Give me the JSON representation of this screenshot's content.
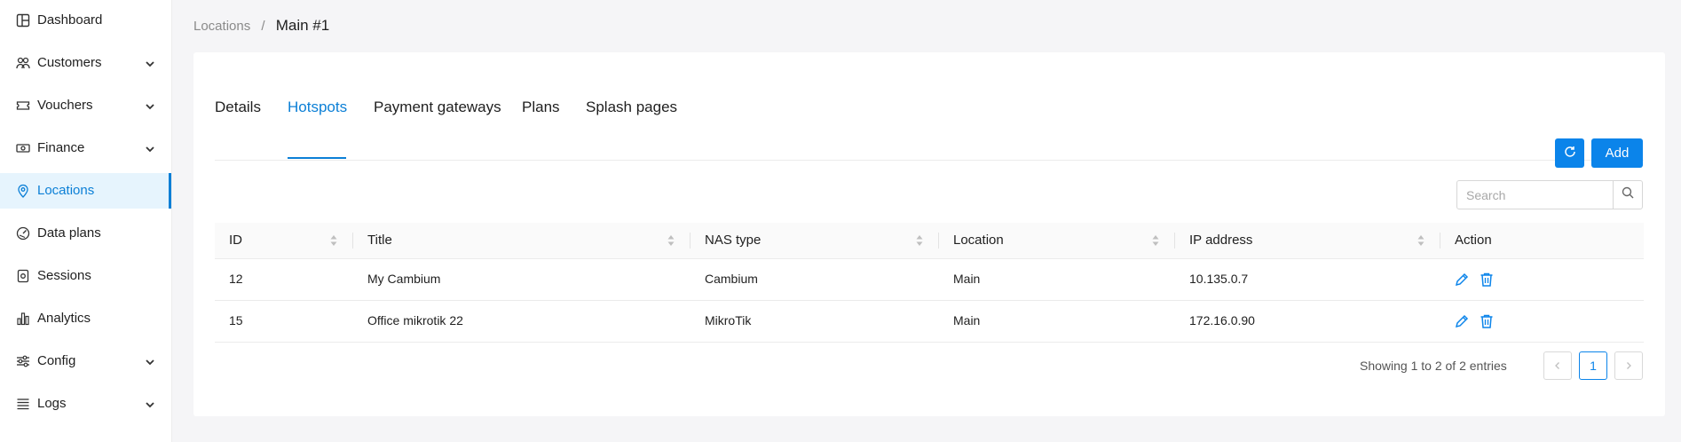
{
  "sidebar": {
    "items": [
      {
        "label": "Dashboard",
        "icon": "dashboard-icon"
      },
      {
        "label": "Customers",
        "icon": "users-icon"
      },
      {
        "label": "Vouchers",
        "icon": "ticket-icon"
      },
      {
        "label": "Finance",
        "icon": "money-icon"
      },
      {
        "label": "Locations",
        "icon": "location-pin-icon"
      },
      {
        "label": "Data plans",
        "icon": "speedometer-icon"
      },
      {
        "label": "Sessions",
        "icon": "sessions-icon"
      },
      {
        "label": "Analytics",
        "icon": "bar-chart-icon"
      },
      {
        "label": "Config",
        "icon": "sliders-icon"
      },
      {
        "label": "Logs",
        "icon": "list-icon"
      }
    ]
  },
  "breadcrumb": {
    "parent": "Locations",
    "separator": "/",
    "current": "Main #1"
  },
  "tabs": [
    "Details",
    "Hotspots",
    "Payment gateways",
    "Plans",
    "Splash pages"
  ],
  "toolbar": {
    "add_label": "Add"
  },
  "search": {
    "placeholder": "Search"
  },
  "table": {
    "columns": [
      "ID",
      "Title",
      "NAS type",
      "Location",
      "IP address",
      "Action"
    ],
    "rows": [
      {
        "id": "12",
        "title": "My Cambium",
        "nas_type": "Cambium",
        "location": "Main",
        "ip": "10.135.0.7"
      },
      {
        "id": "15",
        "title": "Office mikrotik 22",
        "nas_type": "MikroTik",
        "location": "Main",
        "ip": "172.16.0.90"
      }
    ]
  },
  "pagination": {
    "summary": "Showing 1 to 2 of 2 entries",
    "current_page": "1"
  },
  "colors": {
    "accent": "#0b84ea",
    "active_text": "#0b7fd6",
    "active_bg": "#e6f4fd"
  }
}
